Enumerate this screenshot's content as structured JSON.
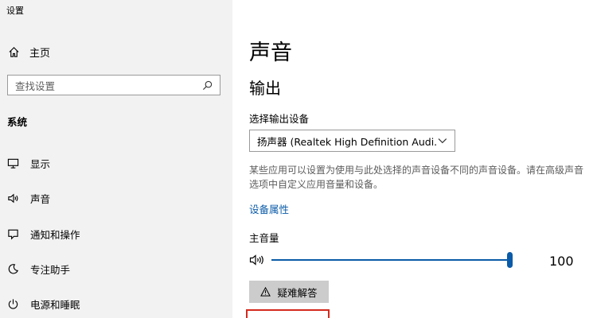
{
  "window": {
    "title": "设置"
  },
  "sidebar": {
    "home_label": "主页",
    "search_placeholder": "查找设置",
    "section": "系统",
    "items": [
      {
        "label": "显示",
        "icon": "monitor-icon"
      },
      {
        "label": "声音",
        "icon": "speaker-icon"
      },
      {
        "label": "通知和操作",
        "icon": "notification-icon"
      },
      {
        "label": "专注助手",
        "icon": "moon-icon"
      },
      {
        "label": "电源和睡眠",
        "icon": "power-icon"
      }
    ]
  },
  "main": {
    "title": "声音",
    "output": {
      "heading": "输出",
      "select_label": "选择输出设备",
      "device": "扬声器 (Realtek High Definition Audi...",
      "description": "某些应用可以设置为使用与此处选择的声音设备不同的声音设备。请在高级声音选项中自定义应用音量和设备。",
      "properties_link": "设备属性",
      "volume_label": "主音量",
      "volume_value": "100",
      "volume_level": 1.0,
      "troubleshoot_label": "疑难解答"
    }
  },
  "colors": {
    "accent": "#0a5ba8",
    "sidebar_bg": "#f2f2f2",
    "highlight": "#d42a1e"
  }
}
